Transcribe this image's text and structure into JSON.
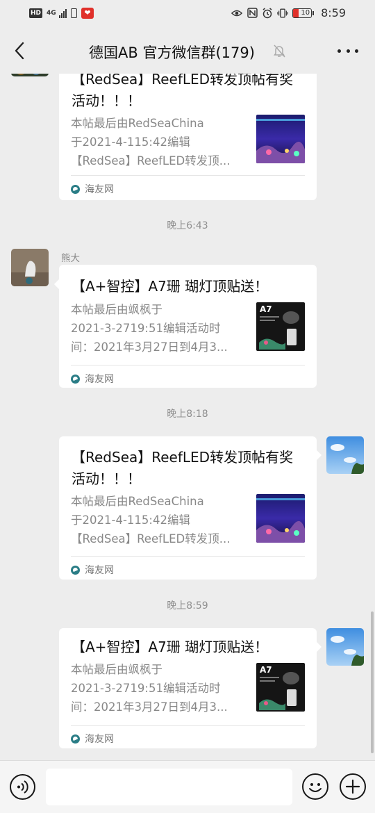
{
  "status_bar": {
    "hd": "HD",
    "network": "4G",
    "app_badge": "❤",
    "battery": "10",
    "battery_level": 0.1,
    "time": "8:59"
  },
  "header": {
    "title": "德国AB  官方微信群(179)"
  },
  "messages": [
    {
      "type": "link-card",
      "direction": "incoming",
      "title": "【RedSea】ReefLED转发顶帖有奖活动！！！",
      "desc_lines": [
        "本帖最后由RedSeaChina",
        "于2021-4-115:42编辑",
        "【RedSea】ReefLED转发顶..."
      ],
      "source": "海友网",
      "thumb": "aquarium-image"
    },
    {
      "type": "timestamp",
      "text": "晚上6:43"
    },
    {
      "type": "link-card",
      "direction": "incoming",
      "sender": "熊大",
      "title": "【A+智控】A7珊 瑚灯顶贴送！",
      "desc_lines": [
        "本帖最后由飒枫于",
        "2021-3-2719:51编辑活动时",
        "间：2021年3月27日到4月3..."
      ],
      "source": "海友网",
      "thumb": "a7-light-image",
      "thumb_label": "A7"
    },
    {
      "type": "timestamp",
      "text": "晚上8:18"
    },
    {
      "type": "link-card",
      "direction": "outgoing",
      "title": "【RedSea】ReefLED转发顶帖有奖活动！！！",
      "desc_lines": [
        "本帖最后由RedSeaChina",
        "于2021-4-115:42编辑",
        "【RedSea】ReefLED转发顶..."
      ],
      "source": "海友网",
      "thumb": "aquarium-image"
    },
    {
      "type": "timestamp",
      "text": "晚上8:59"
    },
    {
      "type": "link-card",
      "direction": "outgoing",
      "title": "【A+智控】A7珊 瑚灯顶贴送！",
      "desc_lines": [
        "本帖最后由飒枫于",
        "2021-3-2719:51编辑活动时",
        "间：2021年3月27日到4月3..."
      ],
      "source": "海友网",
      "thumb": "a7-light-image",
      "thumb_label": "A7"
    }
  ],
  "input_bar": {
    "placeholder": ""
  },
  "colors": {
    "background": "#ededed",
    "card": "#ffffff",
    "muted_text": "#888888",
    "source_icon": "#2a7d86"
  }
}
